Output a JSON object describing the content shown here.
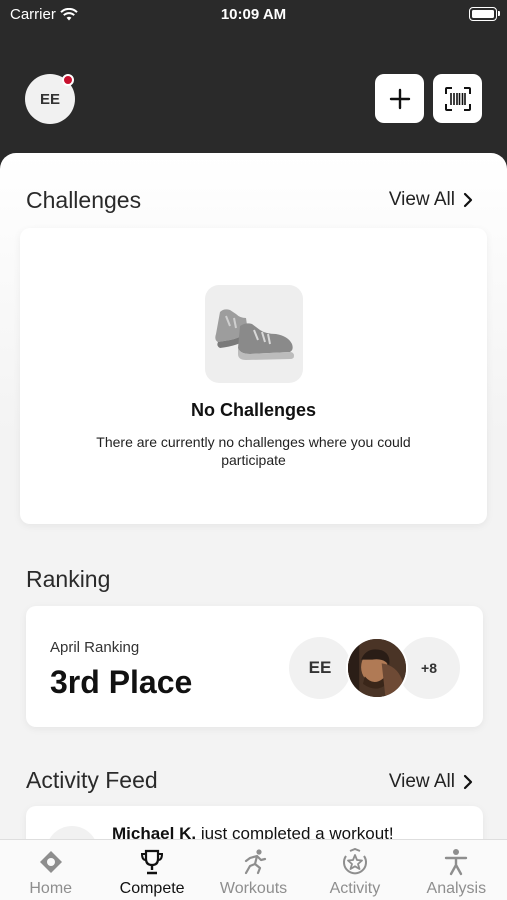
{
  "status_bar": {
    "carrier": "Carrier",
    "time": "10:09 AM"
  },
  "header": {
    "avatar_initials": "EE"
  },
  "challenges": {
    "title": "Challenges",
    "view_all": "View All",
    "empty_title": "No Challenges",
    "empty_description": "There are currently no challenges where you could participate"
  },
  "ranking": {
    "title": "Ranking",
    "subtitle": "April Ranking",
    "place": "3rd Place",
    "participant_initials": "EE",
    "more_count": "+8"
  },
  "activity_feed": {
    "title": "Activity Feed",
    "view_all": "View All",
    "first_item_name": "Michael K.",
    "first_item_text": "just completed a workout!"
  },
  "tabs": [
    {
      "label": "Home",
      "icon": "home-icon"
    },
    {
      "label": "Compete",
      "icon": "trophy-icon"
    },
    {
      "label": "Workouts",
      "icon": "runner-icon"
    },
    {
      "label": "Activity",
      "icon": "activity-star-icon"
    },
    {
      "label": "Analysis",
      "icon": "person-icon"
    }
  ],
  "active_tab": "Compete",
  "colors": {
    "header_bg": "#2a2a2a",
    "notification_dot": "#c8102e",
    "active_tab": "#111111",
    "inactive_tab": "#8e8e8e"
  }
}
